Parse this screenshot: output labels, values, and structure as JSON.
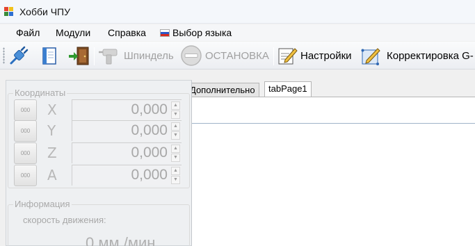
{
  "window": {
    "title": "Хобби ЧПУ"
  },
  "menu": {
    "file": "Файл",
    "modules": "Модули",
    "help": "Справка",
    "language": "Выбор языка"
  },
  "toolbar": {
    "spindle": "Шпиндель",
    "stop": "ОСТАНОВКА",
    "settings": "Настройки",
    "gcode": "Корректировка G-"
  },
  "tabs": [
    {
      "label": "Дополнительно"
    },
    {
      "label": "tabPage1",
      "active": true
    }
  ],
  "coordinates": {
    "title": "Координаты",
    "zero_label": "000",
    "axes": [
      {
        "name": "X",
        "value": "0,000"
      },
      {
        "name": "Y",
        "value": "0,000"
      },
      {
        "name": "Z",
        "value": "0,000"
      },
      {
        "name": "A",
        "value": "0,000"
      }
    ]
  },
  "info": {
    "title": "Информация",
    "speed_label": "скорость движения:",
    "speed_value": "0 мм./мин"
  },
  "icons": {
    "app": "app-window-icon",
    "connect": "usb-plug-icon",
    "open": "open-file-icon",
    "exit": "exit-door-icon",
    "spindle": "drill-icon",
    "stop": "stop-icon",
    "settings": "settings-pencil-icon",
    "gcode": "gcode-edit-icon"
  },
  "colors": {
    "disabled_text": "#a0a0a0",
    "accent": "#3a7dc9"
  }
}
